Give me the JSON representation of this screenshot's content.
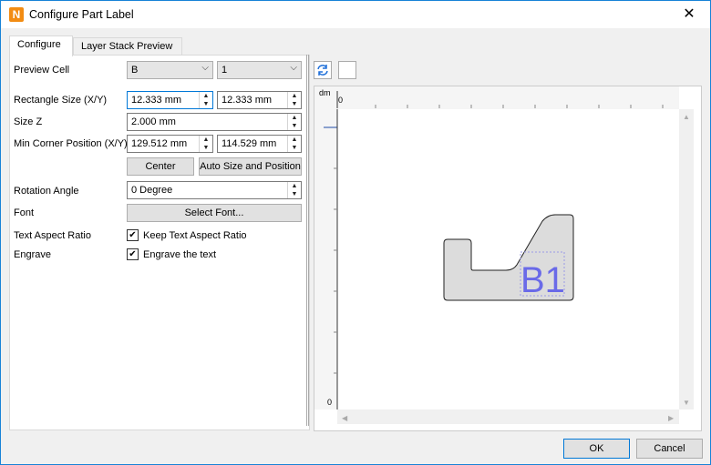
{
  "window": {
    "title": "Configure Part Label",
    "app_icon_letter": "N"
  },
  "tabs": [
    "Configure",
    "Layer Stack Preview"
  ],
  "form": {
    "preview_cell_label": "Preview Cell",
    "preview_cell_value_1": "B",
    "preview_cell_value_2": "1",
    "rect_size_label": "Rectangle Size (X/Y)",
    "rect_size_x": "12.333 mm",
    "rect_size_y": "12.333 mm",
    "size_z_label": "Size Z",
    "size_z": "2.000 mm",
    "min_corner_label": "Min Corner Position (X/Y)",
    "min_corner_x": "129.512 mm",
    "min_corner_y": "114.529 mm",
    "center_button": "Center",
    "auto_size_button": "Auto Size and Position",
    "rotation_label": "Rotation Angle",
    "rotation_value": "0 Degree",
    "font_label": "Font",
    "select_font_button": "Select Font...",
    "aspect_label": "Text Aspect Ratio",
    "keep_aspect_text": "Keep Text Aspect Ratio",
    "keep_aspect_checked": true,
    "engrave_label": "Engrave",
    "engrave_text": "Engrave the text",
    "engrave_checked": true
  },
  "preview": {
    "ruler_unit": "dm",
    "ruler_top_zero": "0",
    "ruler_left_zero": "0",
    "label_text": "B1",
    "label_color": "#6a6ae8",
    "shape_fill": "#dcdcdc"
  },
  "footer": {
    "ok": "OK",
    "cancel": "Cancel"
  }
}
